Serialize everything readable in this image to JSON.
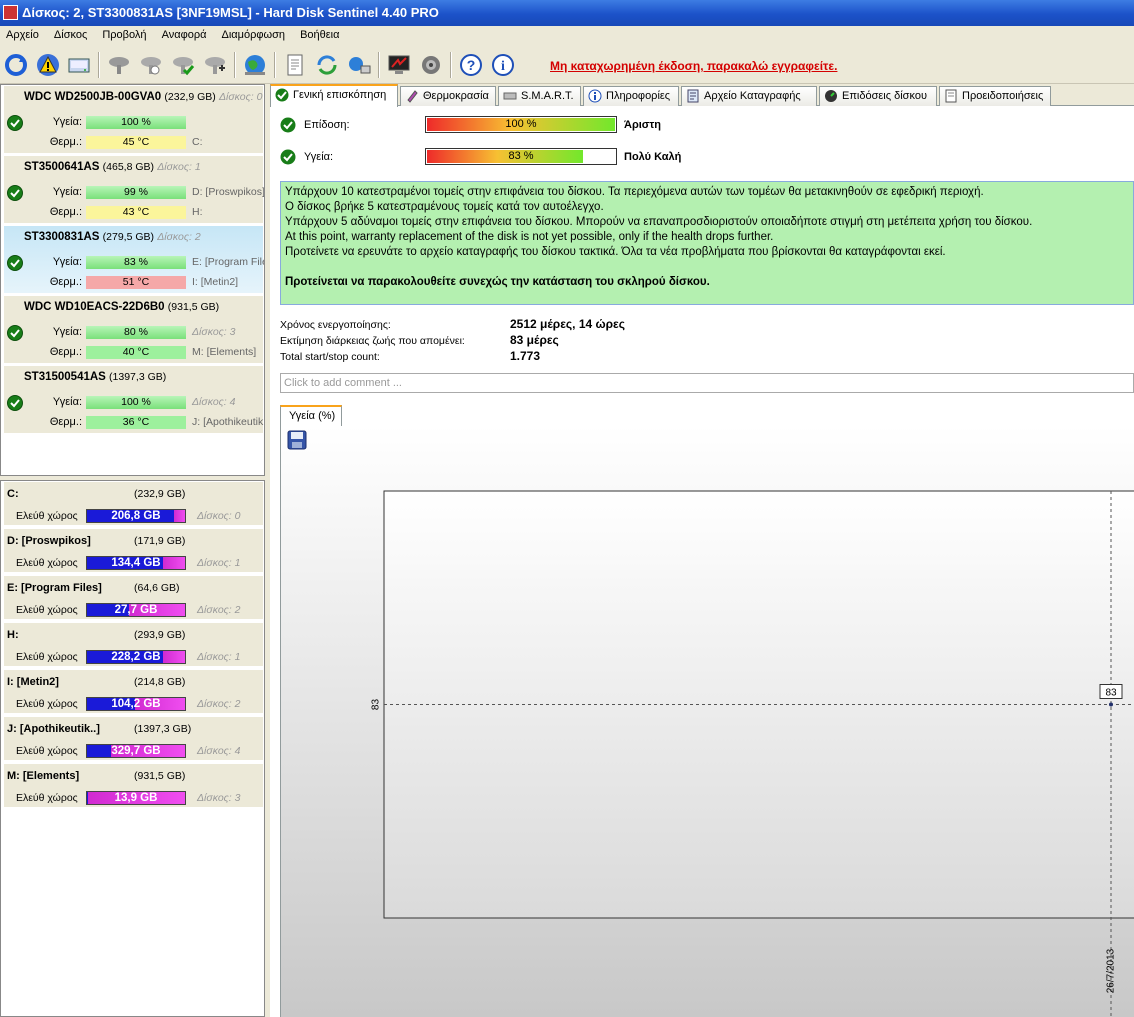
{
  "window": {
    "title": "Δίσκος: 2, ST3300831AS [3NF19MSL]  -  Hard Disk Sentinel 4.40 PRO"
  },
  "menu": [
    "Αρχείο",
    "Δίσκος",
    "Προβολή",
    "Αναφορά",
    "Διαμόρφωση",
    "Βοήθεια"
  ],
  "toolbar": {
    "unregistered_text": "Μη καταχωρημένη έκδοση, παρακαλώ εγγραφείτε."
  },
  "labels": {
    "health": "Υγεία:",
    "temp": "Θερμ.:",
    "free_space": "Ελεύθ χώρος"
  },
  "disks": [
    {
      "name": "WDC WD2500JB-00GVA0",
      "size": "(232,9 GB)",
      "disk_no": "Δίσκος: 0",
      "health": "100 %",
      "temp": "45 °C",
      "drive1": "",
      "drive2": "C:"
    },
    {
      "name": "ST3500641AS",
      "size": "(465,8 GB)",
      "disk_no": "Δίσκος: 1",
      "health": "99 %",
      "temp": "43 °C",
      "drive1": "D: [Proswpikos]",
      "drive2": "H:"
    },
    {
      "name": "ST3300831AS",
      "size": "(279,5 GB)",
      "disk_no": "Δίσκος: 2",
      "health": "83 %",
      "temp": "51 °C",
      "drive1": "E: [Program Files]",
      "drive2": "I: [Metin2]"
    },
    {
      "name": "WDC WD10EACS-22D6B0",
      "size": "(931,5 GB)",
      "disk_no": "Δίσκος: 3",
      "health": "80 %",
      "temp": "40 °C",
      "drive1": "",
      "drive2": "M: [Elements]"
    },
    {
      "name": "ST31500541AS",
      "size": "(1397,3 GB)",
      "disk_no": "Δίσκος: 4",
      "health": "100 %",
      "temp": "36 °C",
      "drive1": "",
      "drive2": "J: [Apothikeutik..]"
    }
  ],
  "partitions": [
    {
      "name": "C:",
      "size": "(232,9 GB)",
      "free": "206,8 GB",
      "free_fraction": 0.89,
      "disk": "Δίσκος: 0"
    },
    {
      "name": "D: [Proswpikos]",
      "size": "(171,9 GB)",
      "free": "134,4 GB",
      "free_fraction": 0.78,
      "disk": "Δίσκος: 1"
    },
    {
      "name": "E: [Program Files]",
      "size": "(64,6 GB)",
      "free": "27,7 GB",
      "free_fraction": 0.43,
      "disk": "Δίσκος: 2"
    },
    {
      "name": "H:",
      "size": "(293,9 GB)",
      "free": "228,2 GB",
      "free_fraction": 0.78,
      "disk": "Δίσκος: 1"
    },
    {
      "name": "I: [Metin2]",
      "size": "(214,8 GB)",
      "free": "104,2 GB",
      "free_fraction": 0.49,
      "disk": "Δίσκος: 2"
    },
    {
      "name": "J: [Apothikeutik..]",
      "size": "(1397,3 GB)",
      "free": "329,7 GB",
      "free_fraction": 0.24,
      "disk": "Δίσκος: 4"
    },
    {
      "name": "M: [Elements]",
      "size": "(931,5 GB)",
      "free": "13,9 GB",
      "free_fraction": 0.01,
      "disk": "Δίσκος: 3"
    }
  ],
  "tabs": [
    "Γενική επισκόπηση",
    "Θερμοκρασία",
    "S.M.A.R.T.",
    "Πληροφορίες",
    "Αρχείο Καταγραφής",
    "Επιδόσεις δίσκου",
    "Προειδοποιήσεις"
  ],
  "overview": {
    "performance_label": "Επίδοση:",
    "performance_value": "100 %",
    "performance_fraction": 1.0,
    "performance_rating": "Άριστη",
    "health_label": "Υγεία:",
    "health_value": "83 %",
    "health_fraction": 0.83,
    "health_rating": "Πολύ Καλή",
    "messages": [
      "Υπάρχουν 10 κατεστραμένοι τομείς στην επιφάνεια του δίσκου. Τα περιεχόμενα αυτών των τομέων θα μετακινηθούν σε εφεδρική περιοχή.",
      "Ο δίσκος βρήκε 5 κατεστραμένους τομείς κατά τον αυτοέλεγχο.",
      "Υπάρχουν 5 αδύναμοι τομείς στην επιφάνεια του δίσκου. Μπορούν να επαναπροσδιοριστούν οποιαδήποτε στιγμή στη μετέπειτα χρήση του δίσκου.",
      "At this point, warranty replacement of the disk is not yet possible, only if the health drops further.",
      "Προτείνετε να ερευνάτε το αρχείο καταγραφής του δίσκου τακτικά. Όλα τα νέα προβλήματα που βρίσκονται θα καταγράφονται εκεί."
    ],
    "recommendation": "Προτείνεται να παρακολουθείτε συνεχώς την κατάσταση του σκληρού δίσκου.",
    "power_on_label": "Χρόνος ενεργοποίησης:",
    "power_on_value": "2512 μέρες, 14 ώρες",
    "lifetime_label": "Εκτίμηση διάρκειας ζωής που απομένει:",
    "lifetime_value": "83 μέρες",
    "startstop_label": "Total start/stop count:",
    "startstop_value": "1.773",
    "comment_placeholder": "Click to add comment ..."
  },
  "chart_tab": "Υγεία (%)",
  "chart_data": {
    "type": "line",
    "x": [
      "26/7/2013"
    ],
    "series": [
      {
        "values": [
          83
        ]
      }
    ],
    "ytick": "83",
    "xtick": "26/7/2013",
    "point_label": "83"
  },
  "colors": {
    "titlebar": "#1c52c9",
    "health_ok": "#9df09d",
    "warning_text": "#d40000",
    "message_bg": "#b4f0b0",
    "free_space_blue": "#1a1ad8",
    "used_space_magenta": "#d12ad1"
  }
}
